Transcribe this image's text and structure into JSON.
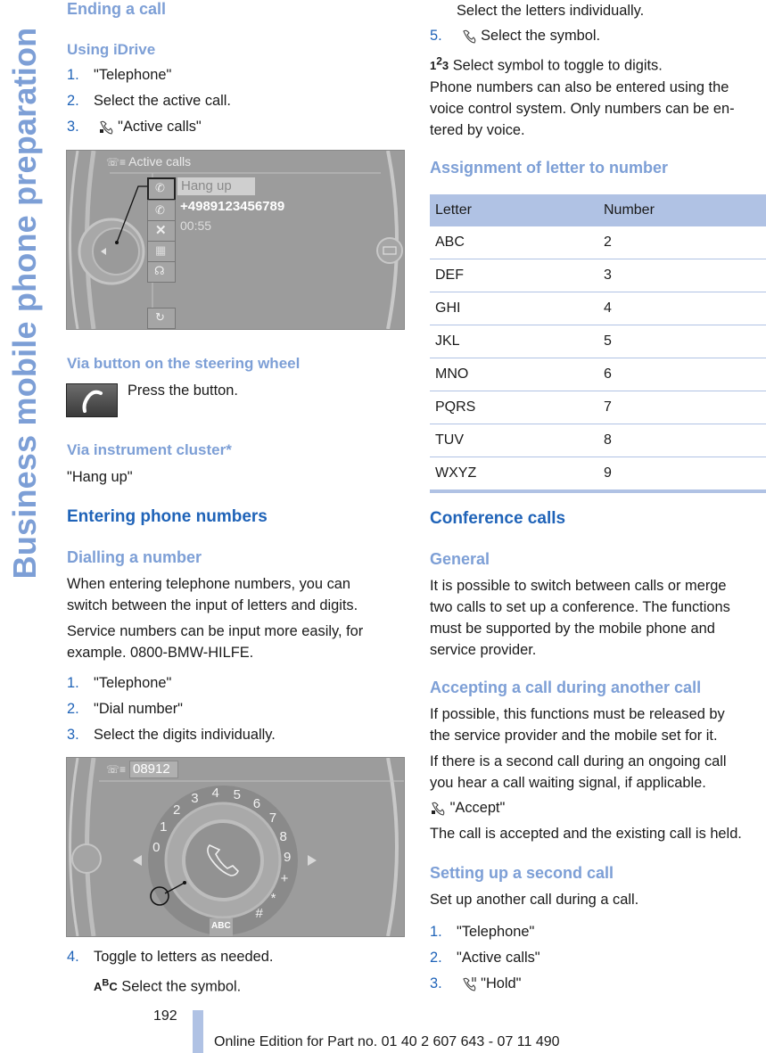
{
  "side_title": "Business mobile phone preparation",
  "left": {
    "ending_call": {
      "title": "Ending a call",
      "using_idrive": "Using iDrive",
      "steps": [
        {
          "num": "1.",
          "text": "\"Telephone\""
        },
        {
          "num": "2.",
          "text": "Select the active call."
        },
        {
          "num": "3.",
          "text": "\"Active calls\"",
          "icon": "phone-hangup-icon"
        }
      ],
      "screen": {
        "title": "Active calls",
        "selected_option": "Hang up",
        "phone_number": "+4989123456789",
        "duration": "00:55",
        "menu_icons": [
          "phone-hangup-icon",
          "phone-hold-icon",
          "mute-microphone-icon",
          "keypad-icon",
          "conference-icon"
        ],
        "bottom_icon": "phone-swap-icon"
      },
      "via_wheel": "Via button on the steering wheel",
      "press_button": "Press the button.",
      "via_cluster": "Via instrument cluster*",
      "cluster_text": "\"Hang up\""
    },
    "entering": {
      "title": "Entering phone numbers",
      "dialling": "Dialling a number",
      "para1": [
        "When entering telephone numbers, you can",
        "switch between the input of letters and digits."
      ],
      "para2": [
        "Service numbers can be input more easily, for",
        "example. 0800-BMW-HILFE."
      ],
      "steps": [
        {
          "num": "1.",
          "text": "\"Telephone\""
        },
        {
          "num": "2.",
          "text": "\"Dial number\""
        },
        {
          "num": "3.",
          "text": "Select the digits individually."
        }
      ],
      "screen": {
        "entered_number": "08912",
        "dial_digits": [
          "0",
          "1",
          "2",
          "3",
          "4",
          "5",
          "6",
          "7",
          "8",
          "9",
          "+",
          "*",
          "#"
        ],
        "toggle_label": "ABC"
      },
      "step4": {
        "num": "4.",
        "text": "Toggle to letters as needed."
      },
      "step4_sub": "Select the symbol.",
      "step4_sub_icon": "abc-toggle-icon"
    }
  },
  "right": {
    "cont_line": "Select the letters individually.",
    "step5": {
      "num": "5.",
      "text": "Select the symbol.",
      "icon": "phone-dial-icon"
    },
    "digits_line": "Select symbol to toggle to digits.",
    "digits_icon": "123-toggle-icon",
    "voice_para": [
      "Phone numbers can also be entered using the",
      "voice control system. Only numbers can be en-",
      "tered by voice."
    ],
    "assignment_title": "Assignment of letter to number",
    "table": {
      "headers": [
        "Letter",
        "Number"
      ],
      "rows": [
        [
          "ABC",
          "2"
        ],
        [
          "DEF",
          "3"
        ],
        [
          "GHI",
          "4"
        ],
        [
          "JKL",
          "5"
        ],
        [
          "MNO",
          "6"
        ],
        [
          "PQRS",
          "7"
        ],
        [
          "TUV",
          "8"
        ],
        [
          "WXYZ",
          "9"
        ]
      ]
    },
    "conference_title": "Conference calls",
    "general_title": "General",
    "general_para": [
      "It is possible to switch between calls or merge",
      "two calls to set up a conference. The functions",
      "must be supported by the mobile phone and",
      "service provider."
    ],
    "accepting_title": "Accepting a call during another call",
    "accepting_para1": [
      "If possible, this functions must be released by",
      "the service provider and the mobile set for it."
    ],
    "accepting_para2": [
      "If there is a second call during an ongoing call",
      "you hear a call waiting signal, if applicable."
    ],
    "accept_text": "\"Accept\"",
    "accepted_para": "The call is accepted and the existing call is held.",
    "second_title": "Setting up a second call",
    "second_para": "Set up another call during a call.",
    "second_steps": [
      {
        "num": "1.",
        "text": "\"Telephone\""
      },
      {
        "num": "2.",
        "text": "\"Active calls\""
      },
      {
        "num": "3.",
        "text": "\"Hold\"",
        "icon": "phone-hold-icon"
      }
    ]
  },
  "footer": {
    "page_number": "192",
    "edition": "Online Edition for Part no. 01 40 2 607 643 - 07 11 490"
  },
  "colors": {
    "heading_dark": "#1f63b8",
    "heading_light": "#7d9fd6",
    "table_accent": "#b0c2e4"
  }
}
